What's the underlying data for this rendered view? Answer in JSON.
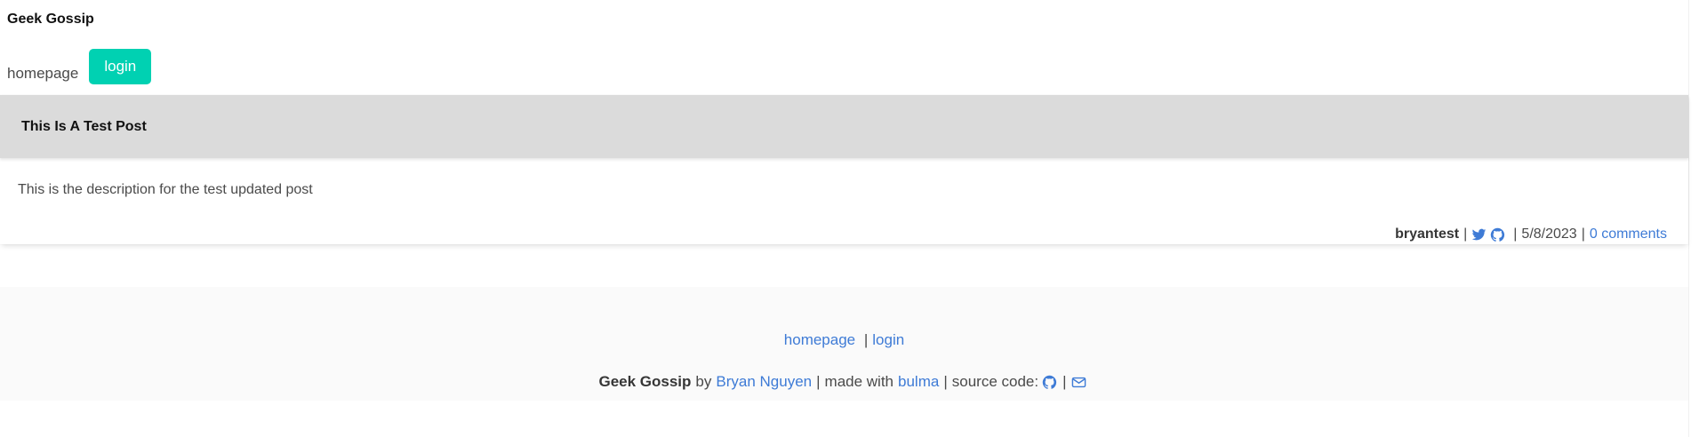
{
  "header": {
    "site_title": "Geek Gossip",
    "nav_home": "homepage",
    "nav_login": "login",
    "login_button_color": "#00d1b2"
  },
  "post": {
    "title": "This Is A Test Post",
    "description": "This is the description for the test updated post",
    "author": "bryantest",
    "date": "5/8/2023",
    "comments_label": "0 comments",
    "icons": [
      "twitter-icon",
      "github-icon"
    ],
    "header_bg": "#dbdbdb"
  },
  "footer": {
    "link_home": "homepage",
    "link_login": "login",
    "site_name": "Geek Gossip",
    "by": "by",
    "author_name": "Bryan Nguyen",
    "made_with": "made with",
    "framework": "bulma",
    "source_code": "source code:",
    "icons": [
      "github-icon",
      "envelope-icon"
    ],
    "link_color": "#3e7bd6"
  },
  "separator": "|"
}
